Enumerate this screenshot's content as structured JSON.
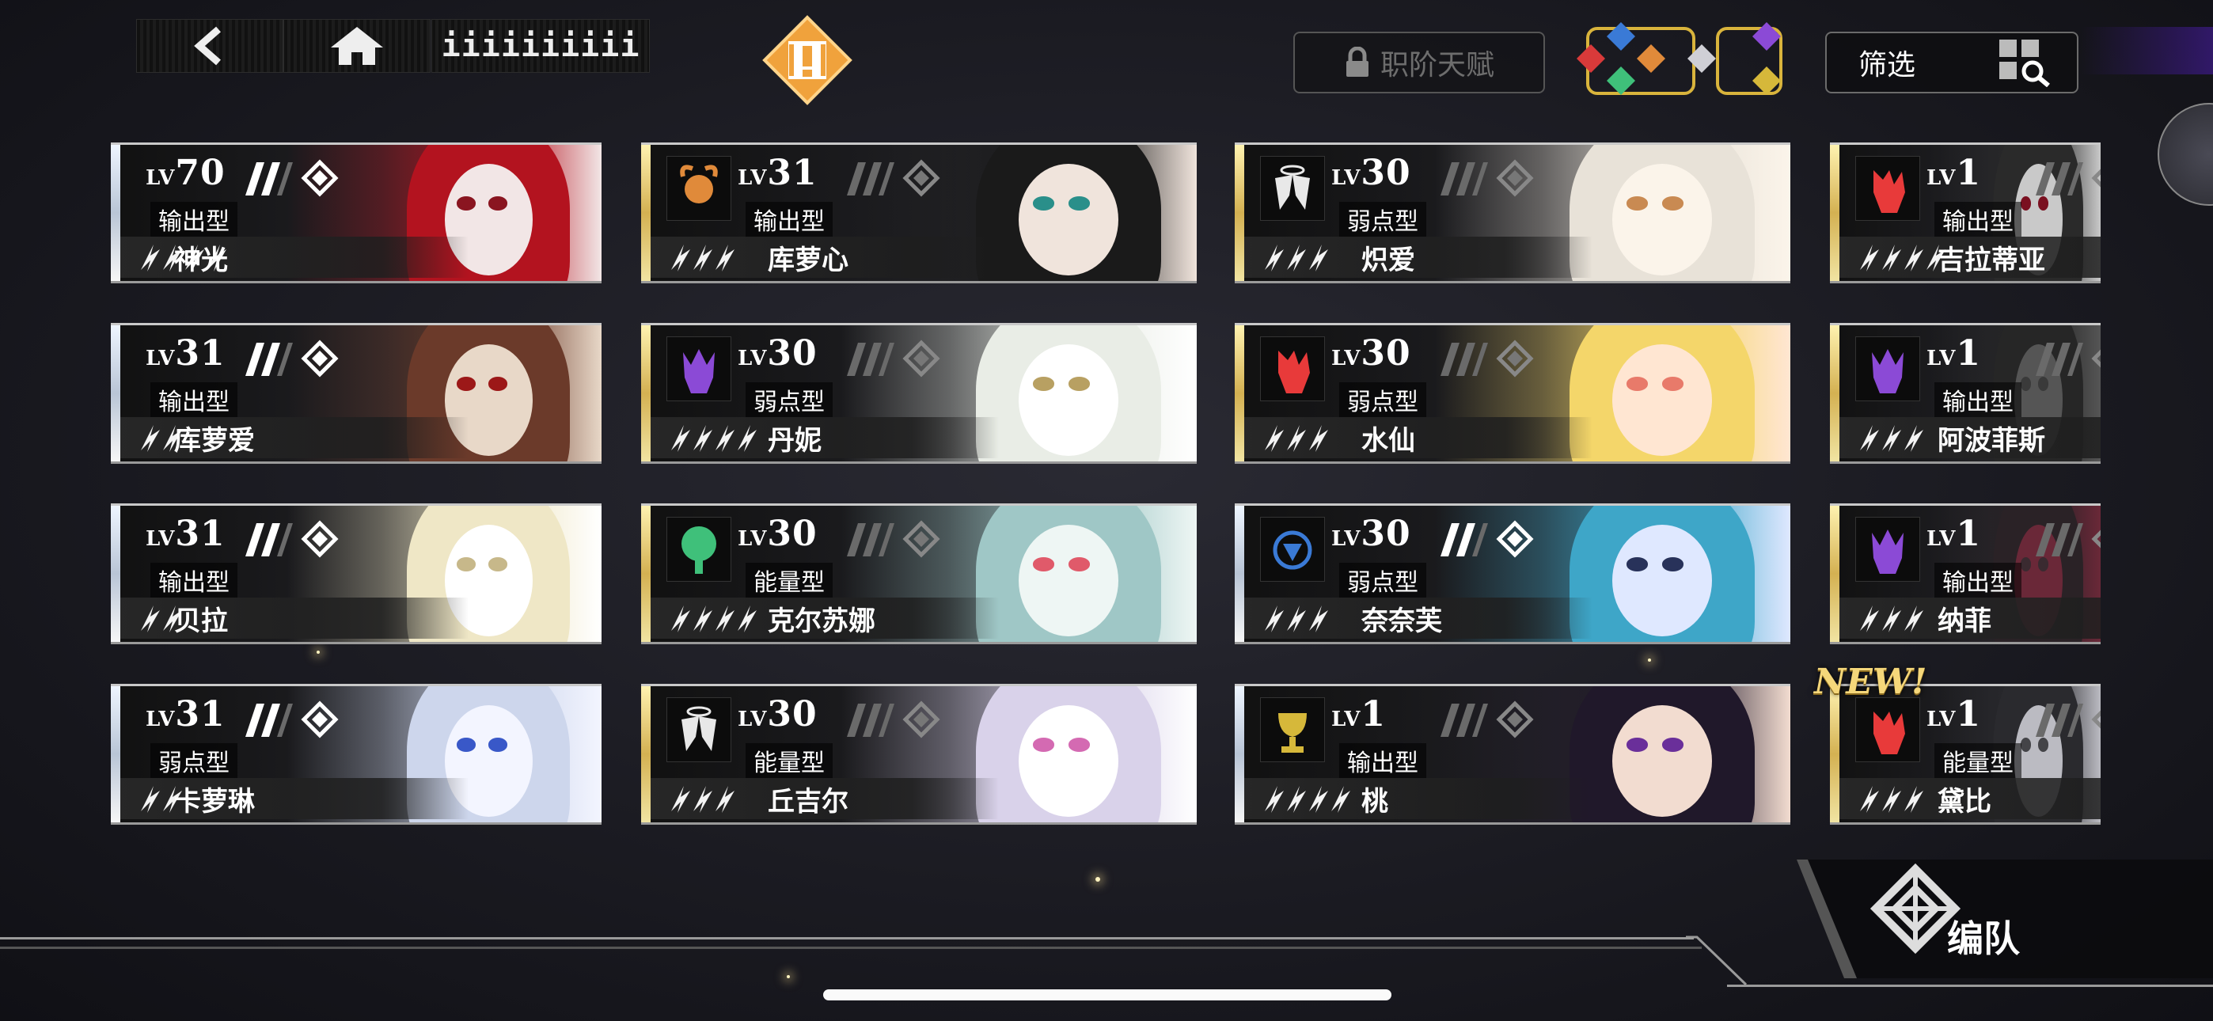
{
  "topbar": {
    "back_icon": "chevron-left-icon",
    "home_icon": "home-icon",
    "player_id": "iiiiiiiiii",
    "alert_icon": "exclamation-diamond-icon"
  },
  "talent": {
    "label": "职阶天赋",
    "icon": "lock-icon"
  },
  "filter": {
    "label": "筛选",
    "icon": "grid-search-icon"
  },
  "formation": {
    "label": "编队",
    "icon": "knot-emblem-icon"
  },
  "new_label": "NEW!",
  "lv_prefix": "LV",
  "columns": [
    [
      {
        "level": "70",
        "type": "输出型",
        "name": "神光",
        "badge": "none",
        "stars": 4,
        "rarity": "silver",
        "palette": [
          "#b3131f",
          "#f2e6e6",
          "#8a1520"
        ]
      },
      {
        "level": "31",
        "type": "输出型",
        "name": "库萝爱",
        "badge": "none",
        "stars": 2,
        "rarity": "silver",
        "palette": [
          "#6b3a2a",
          "#e8d8c8",
          "#9c1818"
        ]
      },
      {
        "level": "31",
        "type": "输出型",
        "name": "贝拉",
        "badge": "none",
        "stars": 2,
        "rarity": "silver",
        "palette": [
          "#efe7c6",
          "#ffffff",
          "#c7b88a"
        ]
      },
      {
        "level": "31",
        "type": "弱点型",
        "name": "卡萝琳",
        "badge": "none",
        "stars": 2,
        "rarity": "silver",
        "palette": [
          "#cdd6ec",
          "#f3f5ff",
          "#3958c8"
        ]
      }
    ],
    [
      {
        "level": "31",
        "type": "输出型",
        "name": "库萝心",
        "badge": "ram",
        "stars": 3,
        "rarity": "gold",
        "palette": [
          "#1a1a1a",
          "#f0e4dc",
          "#2a8f8a"
        ]
      },
      {
        "level": "30",
        "type": "弱点型",
        "name": "丹妮",
        "badge": "demon",
        "stars": 4,
        "rarity": "gold",
        "palette": [
          "#e9ede6",
          "#ffffff",
          "#b8a062"
        ]
      },
      {
        "level": "30",
        "type": "能量型",
        "name": "克尔苏娜",
        "badge": "tree",
        "stars": 4,
        "rarity": "gold",
        "palette": [
          "#9fc7c6",
          "#eef6f4",
          "#e05a6a"
        ]
      },
      {
        "level": "30",
        "type": "能量型",
        "name": "丘吉尔",
        "badge": "wings",
        "stars": 3,
        "rarity": "gold",
        "palette": [
          "#d9d2ea",
          "#ffffff",
          "#d46ab2"
        ]
      }
    ],
    [
      {
        "level": "30",
        "type": "弱点型",
        "name": "炽爱",
        "badge": "wings",
        "stars": 3,
        "rarity": "gold",
        "palette": [
          "#e8e2d8",
          "#fbf4ea",
          "#c98a52"
        ]
      },
      {
        "level": "30",
        "type": "弱点型",
        "name": "水仙",
        "badge": "wolf",
        "stars": 3,
        "rarity": "gold",
        "palette": [
          "#f4d66a",
          "#ffe6d2",
          "#e87a6a"
        ]
      },
      {
        "level": "30",
        "type": "弱点型",
        "name": "奈奈芙",
        "badge": "shield",
        "stars": 3,
        "rarity": "silver",
        "palette": [
          "#3ea6c8",
          "#dfe8ff",
          "#28325a"
        ]
      },
      {
        "level": "1",
        "type": "输出型",
        "name": "桃",
        "badge": "chalice",
        "stars": 4,
        "rarity": "silver",
        "palette": [
          "#20182a",
          "#f2dcd0",
          "#6a2f9a"
        ]
      }
    ],
    [
      {
        "level": "1",
        "type": "输出型",
        "name": "吉拉蒂亚",
        "badge": "wolf",
        "stars": 4,
        "rarity": "gold",
        "palette": [
          "#2a2a2a",
          "#c9c9c9",
          "#7a1020"
        ]
      },
      {
        "level": "1",
        "type": "输出型",
        "name": "阿波菲斯",
        "badge": "demon",
        "stars": 3,
        "rarity": "gold",
        "palette": [
          "#262626",
          "#555555",
          "#3a3a3a"
        ]
      },
      {
        "level": "1",
        "type": "输出型",
        "name": "纳菲",
        "badge": "demon",
        "stars": 3,
        "rarity": "gold",
        "palette": [
          "#2a2226",
          "#6a2838",
          "#3a2a30"
        ]
      },
      {
        "level": "1",
        "type": "能量型",
        "name": "黛比",
        "badge": "wolf",
        "stars": 3,
        "rarity": "gold",
        "palette": [
          "#2a2a2e",
          "#bbbbc2",
          "#444448"
        ],
        "is_new": true
      }
    ]
  ],
  "colors": {
    "wolf": "#e83a3a",
    "demon": "#8b4ad6",
    "tree": "#3fc07a",
    "ram": "#e08a3a",
    "shield": "#3a7ad6",
    "chalice": "#d6b83a",
    "wings": "#e8e8e8"
  }
}
